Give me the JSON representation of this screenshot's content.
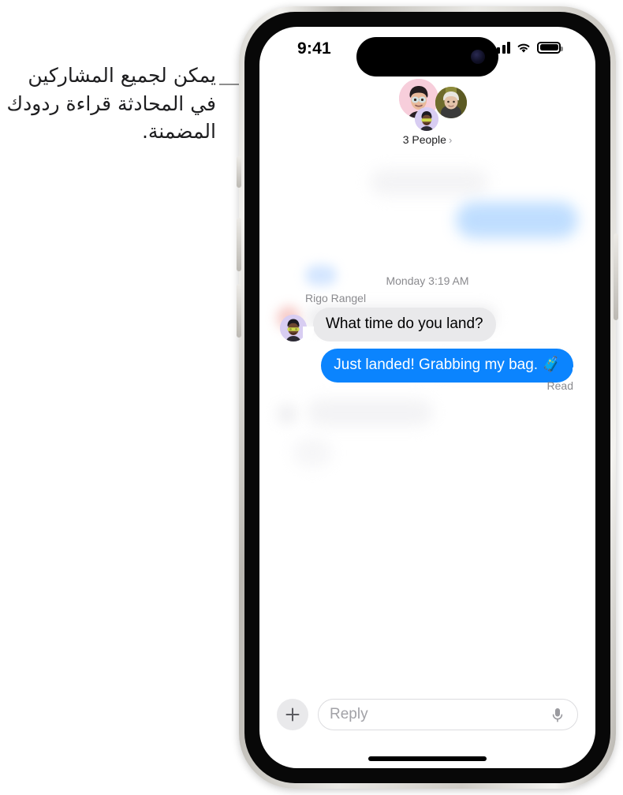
{
  "callout": {
    "text": "يمكن لجميع المشاركين في المحادثة قراءة ردودك المضمنة.",
    "leader_line": "callout-leader-line"
  },
  "status_bar": {
    "time": "9:41",
    "cellular_icon": "signal-bars-icon",
    "wifi_icon": "wifi-icon",
    "battery_icon": "battery-icon"
  },
  "header": {
    "participants_label": "3 People",
    "chevron": "›",
    "avatars": [
      {
        "name": "memoji-pink-avatar",
        "color": "#f7cedb"
      },
      {
        "name": "photo-avatar",
        "color": "#8b8338"
      },
      {
        "name": "memoji-purple-avatar",
        "color": "#d8cdf2"
      }
    ]
  },
  "thread": {
    "timestamp": "Monday 3:19 AM",
    "sender_name": "Rigo Rangel",
    "incoming_message": "What time do you land?",
    "outgoing_message": "Just landed! Grabbing my bag. 🧳",
    "delivery_status": "Read",
    "bubble_colors": {
      "incoming": "#e9e9eb",
      "outgoing": "#0b84fe",
      "secondary_text": "#8a8a8e"
    }
  },
  "composer": {
    "add_button": "+",
    "reply_placeholder": "Reply",
    "mic_icon": "microphone-icon"
  },
  "device": {
    "home_indicator": "home-indicator",
    "buttons": [
      "action-button",
      "volume-up-button",
      "volume-down-button",
      "power-button"
    ]
  }
}
